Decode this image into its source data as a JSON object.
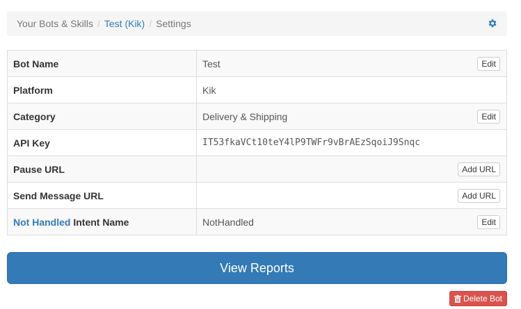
{
  "breadcrumb": {
    "items": [
      "Your Bots & Skills",
      "Test (Kik)",
      "Settings"
    ],
    "separator": "/"
  },
  "settings": {
    "bot_name": {
      "label": "Bot Name",
      "value": "Test",
      "action": "Edit"
    },
    "platform": {
      "label": "Platform",
      "value": "Kik"
    },
    "category": {
      "label": "Category",
      "value": "Delivery & Shipping",
      "action": "Edit"
    },
    "api_key": {
      "label": "API Key",
      "value": "IT53fkaVCt10teY4lP9TWFr9vBrAEzSqoiJ9Snqc"
    },
    "pause_url": {
      "label": "Pause URL",
      "value": "",
      "action": "Add URL"
    },
    "send_message_url": {
      "label": "Send Message URL",
      "value": "",
      "action": "Add URL"
    },
    "not_handled": {
      "label_link": "Not Handled",
      "label_rest": "Intent Name",
      "value": "NotHandled",
      "action": "Edit"
    }
  },
  "actions": {
    "view_reports": "View Reports",
    "delete_bot": "Delete Bot"
  },
  "colors": {
    "primary": "#337ab7",
    "danger": "#d9534f"
  },
  "icons": {
    "settings": "gear-icon",
    "delete": "trash-icon"
  }
}
